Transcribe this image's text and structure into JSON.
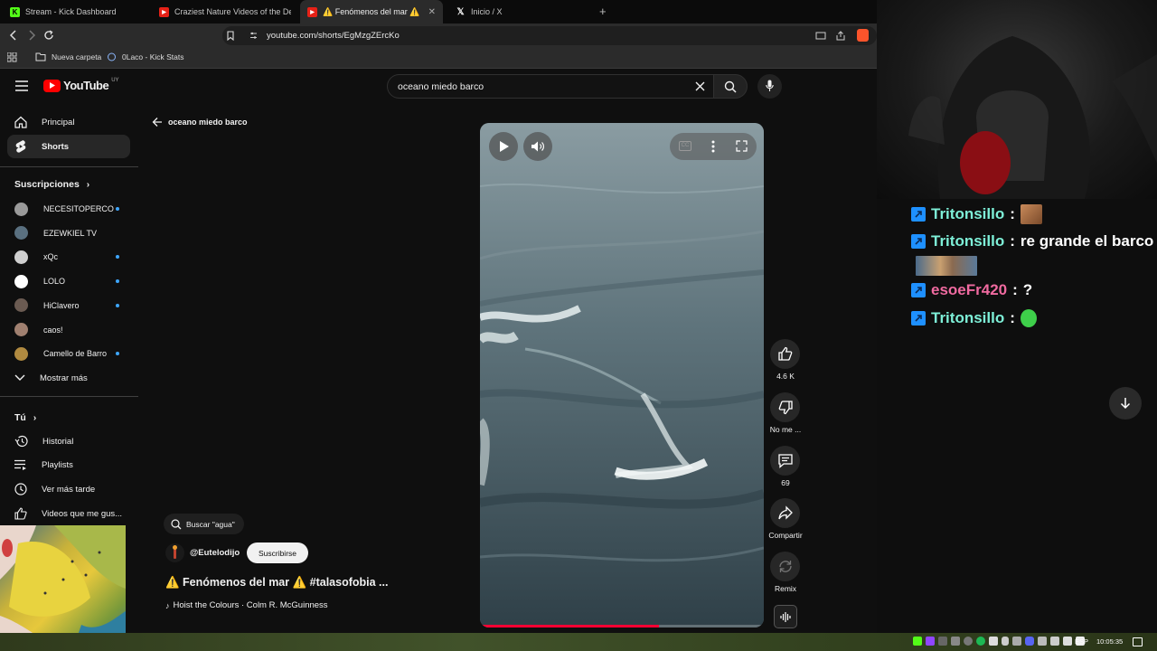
{
  "browser": {
    "tabs": [
      {
        "title": "Stream - Kick Dashboard",
        "icon": "kick-icon",
        "active": false
      },
      {
        "title": "Craziest Nature Videos of the Decade",
        "icon": "youtube-icon",
        "active": false
      },
      {
        "title": "⚠️ Fenómenos del mar ⚠️ #talasofobia",
        "icon": "youtube-icon",
        "active": true
      },
      {
        "title": "Inicio / X",
        "icon": "x-icon",
        "active": false
      }
    ],
    "url": "youtube.com/shorts/EgMzgZErcKo",
    "bookmarks": [
      {
        "label": "Nueva carpeta",
        "icon": "folder-icon"
      },
      {
        "label": "0Laco - Kick Stats",
        "icon": "link-icon"
      }
    ]
  },
  "youtube": {
    "logo_text": "YouTube",
    "region": "UY",
    "search_value": "oceano miedo barco",
    "back_label": "oceano miedo barco",
    "nav": [
      {
        "label": "Principal",
        "icon": "home-icon"
      },
      {
        "label": "Shorts",
        "icon": "shorts-icon",
        "selected": true
      }
    ],
    "subscriptions_title": "Suscripciones",
    "subscriptions": [
      {
        "name": "NECESITOPERCO",
        "dot": true,
        "color": "#9a9a9a"
      },
      {
        "name": "EZEWKIEL TV",
        "dot": false,
        "color": "#5a7080"
      },
      {
        "name": "xQc",
        "dot": true,
        "color": "#cfcfcf"
      },
      {
        "name": "LOLO",
        "dot": true,
        "color": "#ffffff"
      },
      {
        "name": "HiClavero",
        "dot": true,
        "color": "#6b5b52"
      },
      {
        "name": "caos!",
        "dot": false,
        "color": "#a08070"
      },
      {
        "name": "Camello de Barro",
        "dot": true,
        "color": "#b08a40"
      }
    ],
    "show_more": "Mostrar más",
    "you_title": "Tú",
    "you_items": [
      {
        "label": "Historial",
        "icon": "history-icon"
      },
      {
        "label": "Playlists",
        "icon": "playlists-icon"
      },
      {
        "label": "Ver más tarde",
        "icon": "clock-icon"
      },
      {
        "label": "Videos que me gus...",
        "icon": "thumb-up-icon"
      }
    ],
    "short": {
      "search_chip": "Buscar \"agua\"",
      "channel": "@Eutelodijo",
      "subscribe": "Suscribirse",
      "title": "⚠️ Fenómenos del mar ⚠️  #talasofobia ...",
      "music": "Hoist the Colours · Colm R. McGuinness",
      "progress_fraction": 0.63,
      "actions": [
        {
          "label": "4.6 K",
          "icon": "like-icon"
        },
        {
          "label": "No me ...",
          "icon": "dislike-icon"
        },
        {
          "label": "69",
          "icon": "comment-icon"
        },
        {
          "label": "Compartir",
          "icon": "share-icon"
        },
        {
          "label": "Remix",
          "icon": "remix-icon"
        }
      ]
    }
  },
  "chat": [
    {
      "user": "Tritonsillo",
      "text": "",
      "emote": "face-emote",
      "user_color": "#7ef0d8"
    },
    {
      "user": "Tritonsillo",
      "text": "re grande el barco",
      "emote": "image-emote",
      "user_color": "#7ef0d8"
    },
    {
      "user": "esoeFr420",
      "text": "?",
      "emote": "",
      "user_color": "#f06aa0"
    },
    {
      "user": "Tritonsillo",
      "text": "",
      "emote": "pepe-emote",
      "user_color": "#7ef0d8"
    }
  ],
  "taskbar": {
    "language": "ESP",
    "time": "10:05:35"
  }
}
